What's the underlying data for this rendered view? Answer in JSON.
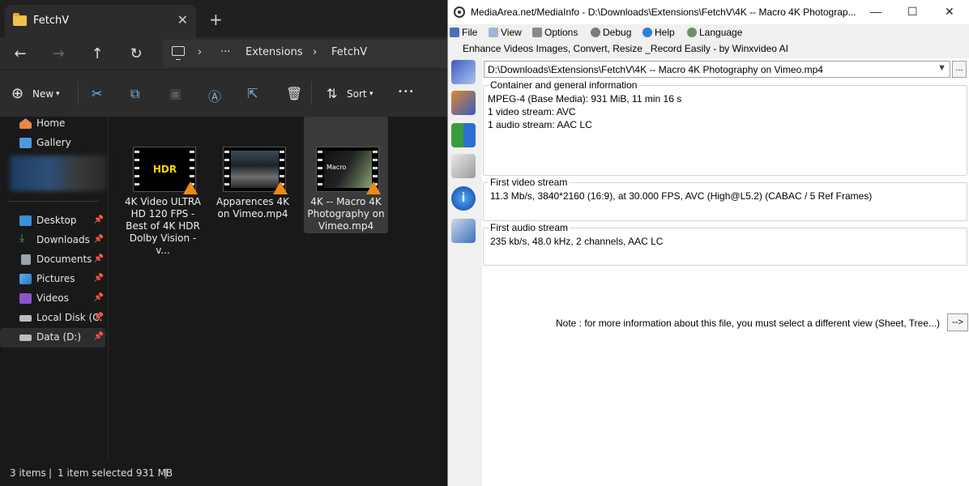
{
  "explorer": {
    "tab_title": "FetchV",
    "close_glyph": "✕",
    "newtab_glyph": "+",
    "breadcrumb": {
      "ellipsis": "···",
      "sep": "›",
      "items": [
        "Extensions",
        "FetchV"
      ]
    },
    "toolbar": {
      "new_label": "New",
      "sort_label": "Sort",
      "more_glyph": "•••"
    },
    "sidebar": {
      "quick": [
        {
          "label": "Home",
          "icon": "home-icon"
        },
        {
          "label": "Gallery",
          "icon": "gallery-icon"
        }
      ],
      "pinned": [
        {
          "label": "Desktop",
          "icon": "desktop-icon",
          "color": "#3a8fd8"
        },
        {
          "label": "Downloads",
          "icon": "downloads-icon",
          "color": "#2fae6b"
        },
        {
          "label": "Documents",
          "icon": "documents-icon",
          "color": "#9aa3ad"
        },
        {
          "label": "Pictures",
          "icon": "pictures-icon",
          "color": "#3f8fd6"
        },
        {
          "label": "Videos",
          "icon": "videos-icon",
          "color": "#8b55c8"
        },
        {
          "label": "Local Disk (C:",
          "icon": "drive-icon",
          "color": "#bdbdbd"
        },
        {
          "label": "Data (D:)",
          "icon": "drive-icon",
          "color": "#bdbdbd"
        }
      ]
    },
    "files": [
      {
        "name": "4K Video ULTRA HD 120 FPS - Best of 4K HDR Dolby Vision - v...",
        "thumb_text": "HDR"
      },
      {
        "name": "Apparences 4K on Vimeo.mp4",
        "thumb_text": ""
      },
      {
        "name": "4K -- Macro 4K Photography on Vimeo.mp4",
        "thumb_text": "Macro"
      }
    ],
    "status": {
      "items": "3 items",
      "selected": "1 item selected  931 MB",
      "sep": "|"
    }
  },
  "mediainfo": {
    "title": "MediaArea.net/MediaInfo - D:\\Downloads\\Extensions\\FetchV\\4K -- Macro 4K Photograp...",
    "menu": [
      {
        "label": "File",
        "icon": "file-icon"
      },
      {
        "label": "View",
        "icon": "view-icon"
      },
      {
        "label": "Options",
        "icon": "options-icon"
      },
      {
        "label": "Debug",
        "icon": "debug-icon"
      },
      {
        "label": "Help",
        "icon": "help-icon"
      },
      {
        "label": "Language",
        "icon": "language-icon"
      }
    ],
    "ad_text": "Enhance Videos  Images, Convert, Resize _Record Easily - by Winxvideo AI",
    "path": "D:\\Downloads\\Extensions\\FetchV\\4K -- Macro 4K Photography on Vimeo.mp4",
    "browse_label": "...",
    "sections": {
      "general": {
        "title": "Container and general information",
        "lines": [
          "MPEG-4 (Base Media): 931 MiB, 11 min 16 s",
          "1 video stream: AVC",
          "1 audio stream: AAC LC"
        ]
      },
      "video": {
        "title": "First video stream",
        "lines": [
          "11.3 Mb/s, 3840*2160 (16:9), at 30.000 FPS, AVC (High@L5.2) (CABAC / 5 Ref Frames)"
        ]
      },
      "audio": {
        "title": "First audio stream",
        "lines": [
          "235 kb/s, 48.0 kHz, 2 channels, AAC LC"
        ]
      }
    },
    "note": "Note : for more information about this file, you must select a different view (Sheet, Tree...)",
    "note_button": "-->"
  }
}
